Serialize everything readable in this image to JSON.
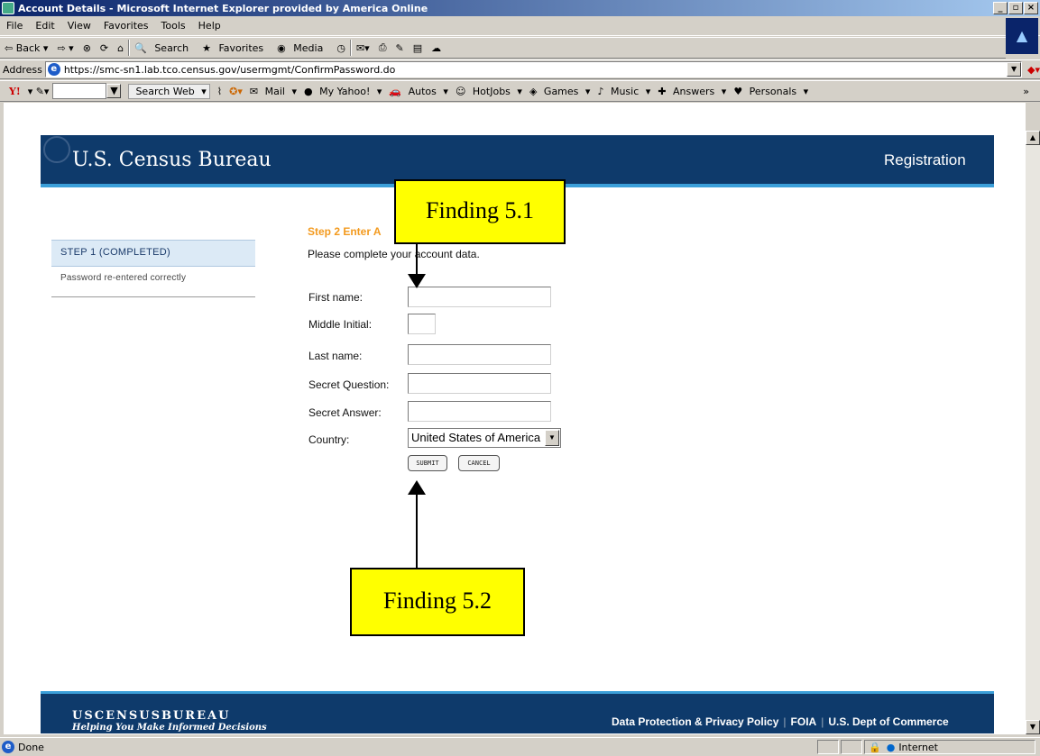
{
  "window": {
    "title": "Account Details - Microsoft Internet Explorer provided by America Online"
  },
  "menu": [
    "File",
    "Edit",
    "View",
    "Favorites",
    "Tools",
    "Help"
  ],
  "toolbar": {
    "back": "⇦ Back ▾",
    "forward": "⇨ ▾",
    "search": "Search",
    "favorites": "Favorites",
    "media": "Media"
  },
  "address": {
    "label": "Address",
    "url": "https://smc-sn1.lab.tco.census.gov/usermgmt/ConfirmPassword.do"
  },
  "yahoo": {
    "search_web": "Search Web",
    "items": [
      "Mail",
      "My Yahoo!",
      "Autos",
      "HotJobs",
      "Games",
      "Music",
      "Answers",
      "Personals"
    ]
  },
  "header": {
    "title": "U.S. Census Bureau",
    "section": "Registration"
  },
  "sidebar": {
    "step1": "STEP 1 (COMPLETED)",
    "step1_note": "Password re-entered correctly"
  },
  "form": {
    "step_heading": "Step 2 Enter A",
    "instruction": "Please complete your account data.",
    "labels": {
      "first": "First name:",
      "middle": "Middle Initial:",
      "last": "Last name:",
      "question": "Secret Question:",
      "answer": "Secret Answer:",
      "country": "Country:"
    },
    "country_value": "United States of America",
    "submit": "SUBMIT",
    "cancel": "CANCEL"
  },
  "callouts": {
    "c1": "Finding 5.1",
    "c2": "Finding 5.2"
  },
  "footer": {
    "brand": "USCENSUSBUREAU",
    "tagline": "Helping You Make Informed Decisions",
    "privacy": "Data Protection & Privacy Policy",
    "foia": "FOIA",
    "commerce": "U.S. Dept of Commerce"
  },
  "status": {
    "text": "Done",
    "zone": "Internet"
  }
}
